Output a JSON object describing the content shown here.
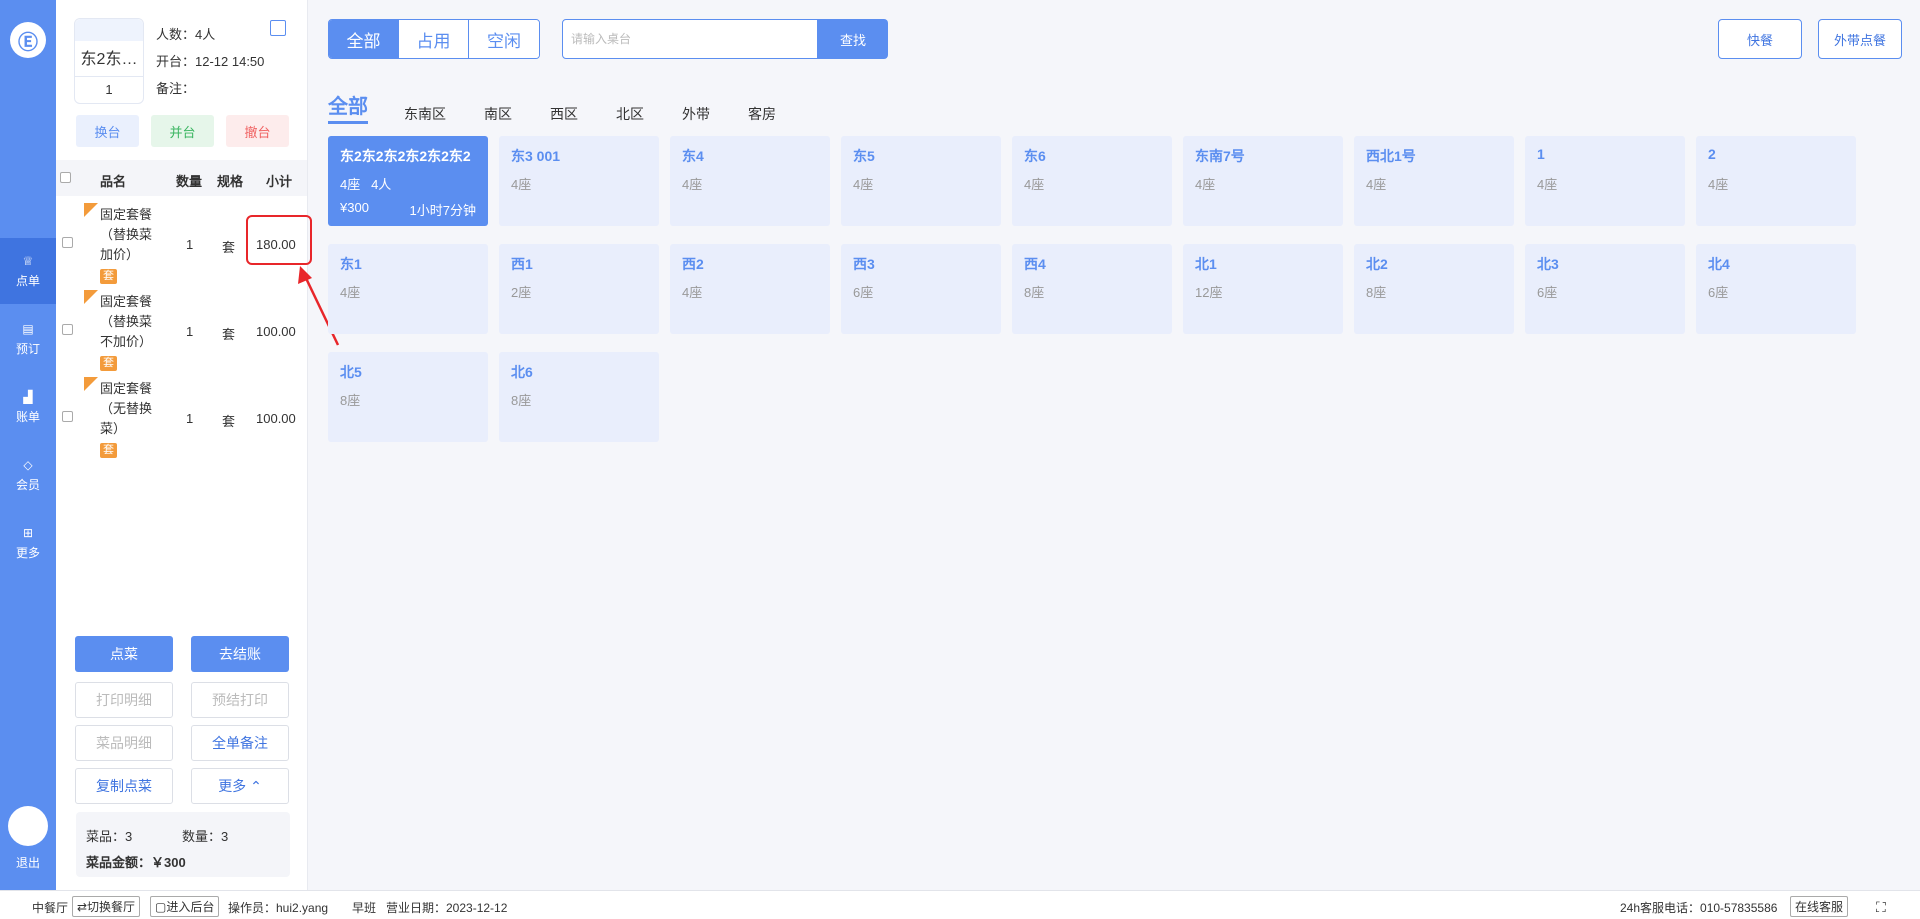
{
  "nav": {
    "items": [
      {
        "label": "点单",
        "icon": "chef-icon",
        "active": true
      },
      {
        "label": "预订",
        "icon": "book-icon"
      },
      {
        "label": "账单",
        "icon": "chart-icon"
      },
      {
        "label": "会员",
        "icon": "diamond-icon"
      },
      {
        "label": "更多",
        "icon": "grid-icon"
      }
    ],
    "exit": "退出"
  },
  "order": {
    "table_name": "东2东…",
    "guest_count": "1",
    "people": "人数：4人",
    "open_time": "开台：12-12 14:50",
    "note": "备注：",
    "actions": [
      "换台",
      "并台",
      "撤台"
    ],
    "headers": [
      "品名",
      "数量",
      "规格",
      "小计"
    ],
    "items": [
      {
        "name": "固定套餐（替换菜加价）",
        "tag": "套",
        "qty": "1",
        "unit": "套",
        "subtotal": "180.00"
      },
      {
        "name": "固定套餐（替换菜不加价）",
        "tag": "套",
        "qty": "1",
        "unit": "套",
        "subtotal": "100.00"
      },
      {
        "name": "固定套餐（无替换菜）",
        "tag": "套",
        "qty": "1",
        "unit": "套",
        "subtotal": "100.00"
      }
    ],
    "buttons": {
      "order": "点菜",
      "checkout": "去结账",
      "print_detail": "打印明细",
      "pre_print": "预结打印",
      "dish_detail": "菜品明细",
      "all_note": "全单备注",
      "copy": "复制点菜",
      "more": "更多 ⌃"
    },
    "summary": {
      "dishes": "菜品：3",
      "quantity": "数量：3",
      "amount": "菜品金额：￥300"
    }
  },
  "main": {
    "filters": [
      "全部",
      "占用",
      "空闲"
    ],
    "search_placeholder": "请输入桌台",
    "search_button": "查找",
    "fast_food": "快餐",
    "takeout": "外带点餐",
    "zones": [
      "全部",
      "东南区",
      "南区",
      "西区",
      "北区",
      "外带",
      "客房"
    ],
    "tables": [
      {
        "name": "东2东2东2东2东2东2",
        "seats": "4座",
        "people": "4人",
        "price": "¥300",
        "duration": "1小时7分钟",
        "busy": true
      },
      {
        "name": "东3 001",
        "seats": "4座"
      },
      {
        "name": "东4",
        "seats": "4座"
      },
      {
        "name": "东5",
        "seats": "4座"
      },
      {
        "name": "东6",
        "seats": "4座"
      },
      {
        "name": "东南7号",
        "seats": "4座"
      },
      {
        "name": "西北1号",
        "seats": "4座"
      },
      {
        "name": "1",
        "seats": "4座"
      },
      {
        "name": "2",
        "seats": "4座"
      },
      {
        "name": "东1",
        "seats": "4座"
      },
      {
        "name": "西1",
        "seats": "2座"
      },
      {
        "name": "西2",
        "seats": "4座"
      },
      {
        "name": "西3",
        "seats": "6座"
      },
      {
        "name": "西4",
        "seats": "8座"
      },
      {
        "name": "北1",
        "seats": "12座"
      },
      {
        "name": "北2",
        "seats": "8座"
      },
      {
        "name": "北3",
        "seats": "6座"
      },
      {
        "name": "北4",
        "seats": "6座"
      },
      {
        "name": "北5",
        "seats": "8座"
      },
      {
        "name": "北6",
        "seats": "8座"
      }
    ]
  },
  "footer": {
    "restaurant": "中餐厅",
    "switch": "⇄切换餐厅",
    "backend": "▢进入后台",
    "operator": "操作员：hui2.yang",
    "shift": "早班",
    "date": "营业日期：2023-12-12",
    "phone": "24h客服电话：010-57835586",
    "online": "在线客服"
  }
}
